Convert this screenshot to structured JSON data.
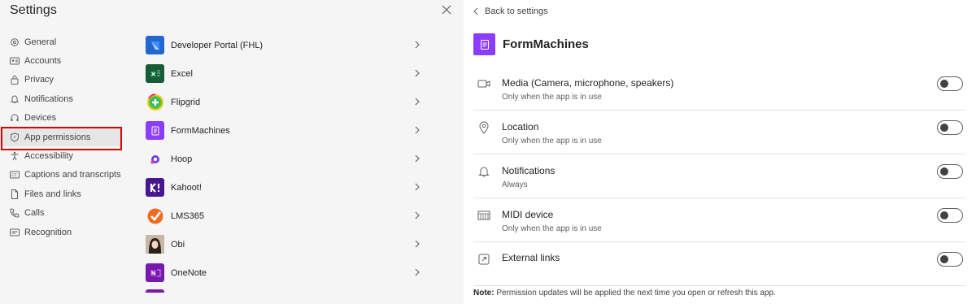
{
  "dialog": {
    "title": "Settings"
  },
  "nav": {
    "items": [
      {
        "label": "General",
        "icon": "gear-icon"
      },
      {
        "label": "Accounts",
        "icon": "account-card-icon"
      },
      {
        "label": "Privacy",
        "icon": "lock-icon"
      },
      {
        "label": "Notifications",
        "icon": "bell-icon"
      },
      {
        "label": "Devices",
        "icon": "headset-icon"
      },
      {
        "label": "App permissions",
        "icon": "shield-icon",
        "active": true
      },
      {
        "label": "Accessibility",
        "icon": "accessibility-icon"
      },
      {
        "label": "Captions and transcripts",
        "icon": "cc-icon"
      },
      {
        "label": "Files and links",
        "icon": "file-icon"
      },
      {
        "label": "Calls",
        "icon": "phone-icon"
      },
      {
        "label": "Recognition",
        "icon": "id-icon"
      }
    ]
  },
  "apps": {
    "items": [
      {
        "name": "Developer Portal (FHL)",
        "color": "#2266d0"
      },
      {
        "name": "Excel",
        "color": "#185c37"
      },
      {
        "name": "Flipgrid",
        "color": "#5ac72f"
      },
      {
        "name": "FormMachines",
        "color": "#8b3dff"
      },
      {
        "name": "Hoop",
        "color": "#6a3df5"
      },
      {
        "name": "Kahoot!",
        "color": "#46178f"
      },
      {
        "name": "LMS365",
        "color": "#ee6c22"
      },
      {
        "name": "Obi",
        "color": "#b07a5a"
      },
      {
        "name": "OneNote",
        "color": "#7719aa"
      }
    ]
  },
  "detail": {
    "back_label": "Back to settings",
    "app_title": "FormMachines",
    "accent": "#8b3dff",
    "permissions": [
      {
        "name": "Media (Camera, microphone, speakers)",
        "sub": "Only when the app is in use",
        "icon": "camera-icon",
        "enabled": false
      },
      {
        "name": "Location",
        "sub": "Only when the app is in use",
        "icon": "location-pin-icon",
        "enabled": false
      },
      {
        "name": "Notifications",
        "sub": "Always",
        "icon": "bell-icon",
        "enabled": false
      },
      {
        "name": "MIDI device",
        "sub": "Only when the app is in use",
        "icon": "midi-keyboard-icon",
        "enabled": false
      },
      {
        "name": "External links",
        "sub": "",
        "icon": "external-link-icon",
        "enabled": false
      }
    ],
    "note_label": "Note:",
    "note_text": " Permission updates will be applied the next time you open or refresh this app."
  }
}
